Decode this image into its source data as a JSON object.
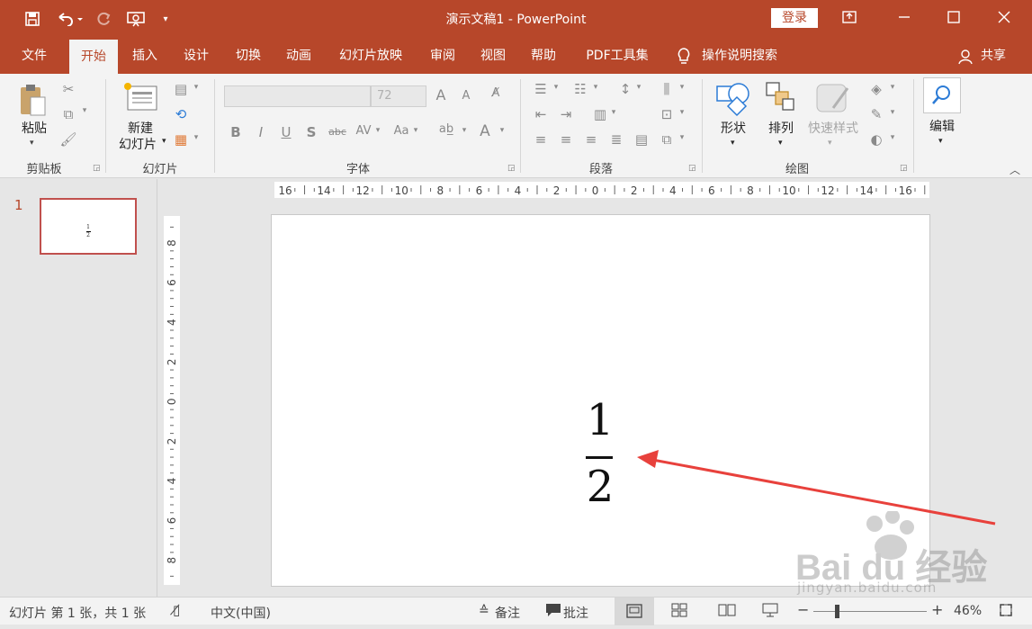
{
  "titlebar": {
    "title": "演示文稿1  -  PowerPoint",
    "login_label": "登录",
    "qat": [
      "save-icon",
      "undo-icon",
      "redo-icon",
      "present-icon",
      "customize-icon"
    ]
  },
  "tabs": [
    {
      "label": "文件"
    },
    {
      "label": "开始"
    },
    {
      "label": "插入"
    },
    {
      "label": "设计"
    },
    {
      "label": "切换"
    },
    {
      "label": "动画"
    },
    {
      "label": "幻灯片放映"
    },
    {
      "label": "审阅"
    },
    {
      "label": "视图"
    },
    {
      "label": "帮助"
    },
    {
      "label": "PDF工具集"
    }
  ],
  "tell_me": "操作说明搜索",
  "share_label": "共享",
  "ribbon": {
    "clipboard": {
      "paste_label": "粘贴",
      "group_label": "剪贴板"
    },
    "slides": {
      "new_slide_label_1": "新建",
      "new_slide_label_2": "幻灯片",
      "group_label": "幻灯片"
    },
    "font": {
      "size_value": "72",
      "group_label": "字体",
      "bold": "B",
      "italic": "I",
      "underline": "U",
      "shadow": "S",
      "strike": "abc",
      "spacing": "AV",
      "case": "Aa",
      "grow": "A",
      "shrink": "A",
      "color": "A"
    },
    "paragraph": {
      "group_label": "段落"
    },
    "drawing": {
      "shapes_label": "形状",
      "arrange_label": "排列",
      "quick_styles_label": "快速样式",
      "group_label": "绘图"
    },
    "editing": {
      "label": "编辑"
    }
  },
  "thumbnail": {
    "number": "1",
    "numerator": "1",
    "denominator": "2"
  },
  "slide": {
    "numerator": "1",
    "denominator": "2"
  },
  "hruler_labels": [
    "16",
    "14",
    "12",
    "10",
    "8",
    "6",
    "4",
    "2",
    "0",
    "2",
    "4",
    "6",
    "8",
    "10",
    "12",
    "14",
    "16"
  ],
  "vruler_labels": [
    "8",
    "6",
    "4",
    "2",
    "0",
    "2",
    "4",
    "6",
    "8"
  ],
  "statusbar": {
    "slide_info": "幻灯片 第 1 张，共 1 张",
    "language": "中文(中国)",
    "notes_label": "备注",
    "comments_label": "批注",
    "zoom": "46%"
  },
  "watermark": {
    "brand": "Bai du 经验",
    "url": "jingyan.baidu.com"
  },
  "colors": {
    "accent": "#b7472a",
    "arrow": "#e8413c"
  }
}
